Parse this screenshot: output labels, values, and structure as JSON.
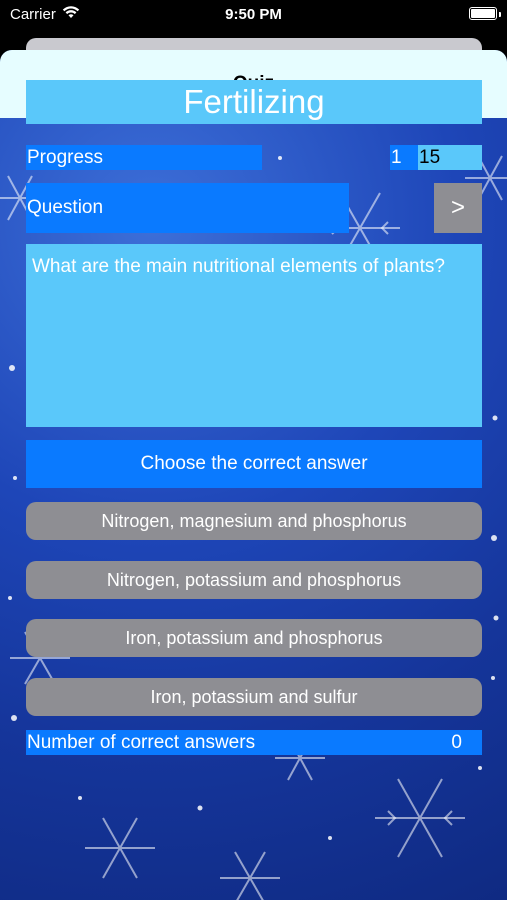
{
  "status_bar": {
    "carrier": "Carrier",
    "time": "9:50 PM"
  },
  "nav": {
    "title": "Quiz"
  },
  "quiz": {
    "topic": "Fertilizing",
    "progress_label": "Progress",
    "progress_current": "1",
    "progress_total": "15",
    "question_label": "Question",
    "next_label": ">",
    "question_text": "What are the main nutritional elements of plants?",
    "choose_label": "Choose the correct answer",
    "answers": [
      "Nitrogen, magnesium and phosphorus",
      "Nitrogen, potassium and phosphorus",
      "Iron, potassium and phosphorus",
      "Iron, potassium and sulfur"
    ],
    "correct_label": "Number of correct answers",
    "correct_count": "0"
  },
  "colors": {
    "accent_blue": "#0a7aff",
    "light_blue": "#5ac8fa",
    "button_gray": "#8e8e93",
    "nav_bg": "#e6fdff"
  },
  "icons": {
    "wifi": "wifi-icon",
    "battery": "battery-icon"
  }
}
